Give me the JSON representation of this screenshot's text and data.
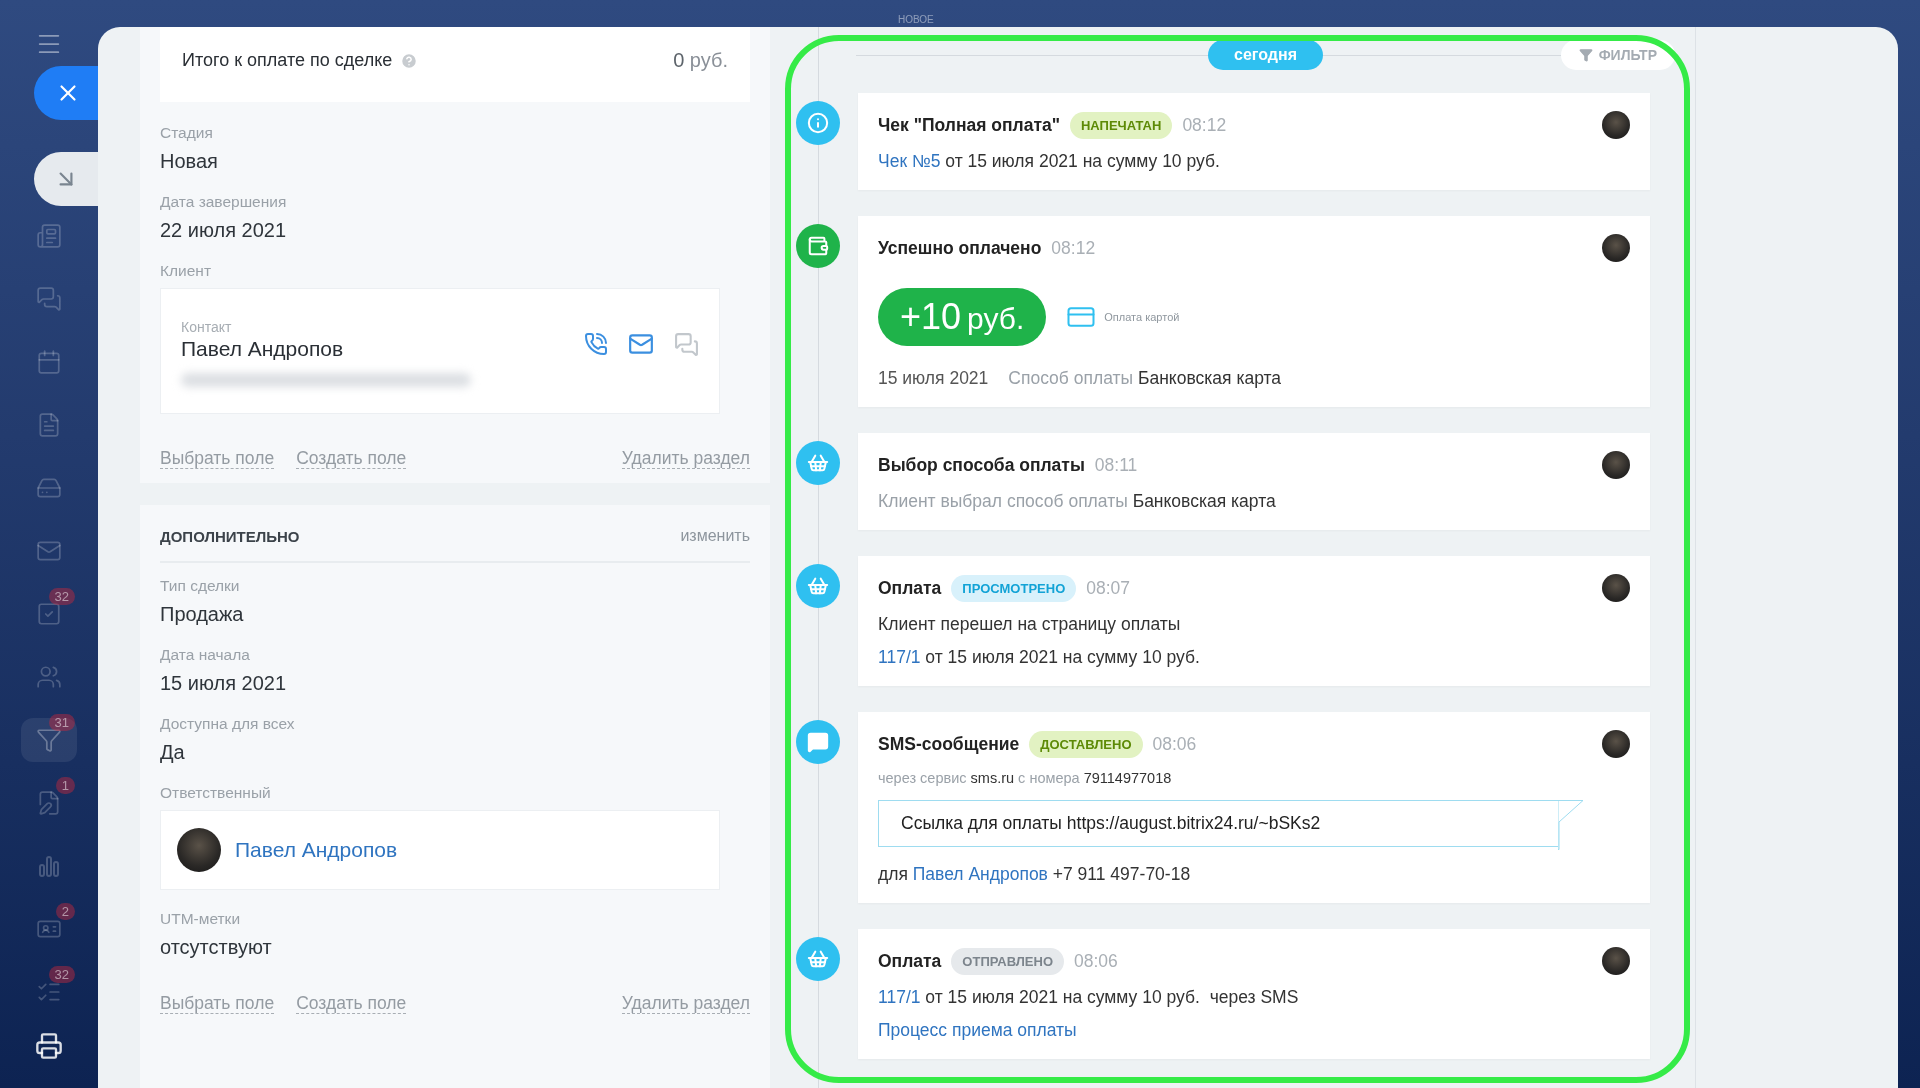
{
  "top_bar": {
    "label": "НОВОЕ"
  },
  "sidebar": {
    "items": [
      {
        "kind": "news",
        "selected": false
      },
      {
        "kind": "chat",
        "selected": false
      },
      {
        "kind": "calendar",
        "selected": false
      },
      {
        "kind": "document",
        "selected": false
      },
      {
        "kind": "drive",
        "selected": false
      },
      {
        "kind": "mail",
        "selected": false
      },
      {
        "kind": "tasks",
        "badge": "32",
        "selected": false
      },
      {
        "kind": "contacts",
        "selected": false
      },
      {
        "kind": "funnel",
        "badge": "31",
        "selected": true
      },
      {
        "kind": "edit",
        "badge": "1",
        "selected": false
      },
      {
        "kind": "chart",
        "selected": false
      },
      {
        "kind": "card",
        "badge": "2",
        "selected": false
      },
      {
        "kind": "list",
        "badge": "32",
        "selected": false
      }
    ]
  },
  "left_panel": {
    "summary": {
      "label": "Итого к оплате по сделке",
      "amount": "0",
      "currency": "руб."
    },
    "sections": [
      {
        "fields": [
          {
            "kind": "text",
            "label": "Стадия",
            "value": "Новая"
          },
          {
            "kind": "text",
            "label": "Дата завершения",
            "value": "22 июля 2021"
          },
          {
            "kind": "contact",
            "label": "Клиент",
            "caption": "Контакт",
            "value": "Павел Андропов"
          }
        ],
        "actions": [
          "Выбрать поле",
          "Создать поле"
        ],
        "delete": "Удалить раздел"
      },
      {
        "title": "ДОПОЛНИТЕЛЬНО",
        "edit": "изменить",
        "fields": [
          {
            "kind": "text",
            "label": "Тип сделки",
            "value": "Продажа"
          },
          {
            "kind": "text",
            "label": "Дата начала",
            "value": "15 июля 2021"
          },
          {
            "kind": "text",
            "label": "Доступна для всех",
            "value": "Да"
          },
          {
            "kind": "user",
            "label": "Ответственный",
            "value": "Павел Андропов"
          },
          {
            "kind": "text",
            "label": "UTM-метки",
            "value": "отсутствуют"
          }
        ],
        "actions": [
          "Выбрать поле",
          "Создать поле"
        ],
        "delete": "Удалить раздел"
      }
    ]
  },
  "timeline": {
    "date": "сегодня",
    "filter": "ФИЛЬТР",
    "events": [
      {
        "kind": "info",
        "title": "Чек \"Полная оплата\"",
        "status": {
          "kind": "success",
          "label": "НАПЕЧАТАН"
        },
        "time": "08:12",
        "lines": [
          [
            {
              "kind": "link",
              "text": "Чек №5"
            },
            {
              "kind": "text",
              "text": " от 15 июля 2021 на сумму 10 руб."
            }
          ]
        ]
      },
      {
        "kind": "wallet",
        "title": "Успешно оплачено",
        "time": "08:12",
        "payment": {
          "amount": "+10",
          "currency": "руб.",
          "method": "Оплата картой",
          "date": "15 июля 2021",
          "label": "Способ оплаты",
          "value": "Банковская карта"
        }
      },
      {
        "kind": "basket",
        "title": "Выбор способа оплаты",
        "time": "08:11",
        "lines": [
          [
            {
              "kind": "muted",
              "text": "Клиент выбрал способ оплаты "
            },
            {
              "kind": "text",
              "text": "Банковская карта"
            }
          ]
        ]
      },
      {
        "kind": "basket",
        "title": "Оплата",
        "status": {
          "kind": "info",
          "label": "ПРОСМОТРЕНО"
        },
        "time": "08:07",
        "lines": [
          [
            {
              "kind": "text",
              "text": "Клиент перешел на страницу оплаты"
            }
          ],
          [
            {
              "kind": "link",
              "text": "117/1"
            },
            {
              "kind": "text",
              "text": " от 15 июля 2021 на сумму 10 руб."
            }
          ]
        ]
      },
      {
        "kind": "chat",
        "title": "SMS-сообщение",
        "status": {
          "kind": "success",
          "label": "ДОСТАВЛЕНО"
        },
        "time": "08:06",
        "subline": [
          {
            "kind": "muted",
            "text": "через сервис "
          },
          {
            "kind": "text",
            "text": "sms.ru"
          },
          {
            "kind": "muted",
            "text": " с номера "
          },
          {
            "kind": "text",
            "text": "79114977018"
          }
        ],
        "message": "Ссылка для оплаты https://august.bitrix24.ru/~bSKs2",
        "lines": [
          [
            {
              "kind": "text",
              "text": "для "
            },
            {
              "kind": "link",
              "text": "Павел Андропов"
            },
            {
              "kind": "text",
              "text": " +7 911 497-70-18"
            }
          ]
        ]
      },
      {
        "kind": "basket",
        "title": "Оплата",
        "status": {
          "kind": "neutral",
          "label": "ОТПРАВЛЕНО"
        },
        "time": "08:06",
        "lines": [
          [
            {
              "kind": "link",
              "text": "117/1"
            },
            {
              "kind": "text",
              "text": " от 15 июля 2021 на сумму 10 руб.  через SMS"
            }
          ],
          [
            {
              "kind": "link",
              "text": "Процесс приема оплаты"
            }
          ]
        ]
      }
    ]
  }
}
